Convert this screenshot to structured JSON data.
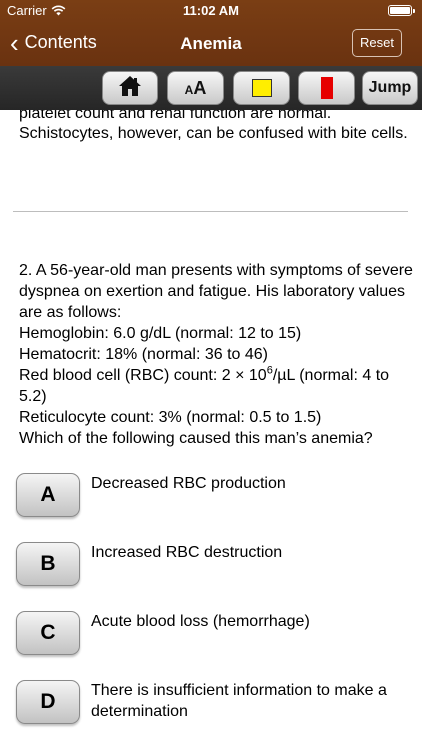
{
  "status_bar": {
    "carrier": "Carrier",
    "time": "11:02 AM"
  },
  "nav": {
    "back_label": "Contents",
    "title": "Anemia",
    "reset_label": "Reset"
  },
  "toolbar": {
    "font_label_small": "A",
    "font_label_large": "A",
    "jump_label": "Jump",
    "highlight_color": "#ffee00",
    "marker_color": "#e60000"
  },
  "previous_text": {
    "line1": "platelet count and renal function are normal.",
    "line2": "Schistocytes, however, can be confused with bite cells."
  },
  "question": {
    "intro": "2. A 56-year-old man presents with symptoms of severe dyspnea on exertion and fatigue. His laboratory values are as follows:",
    "hemoglobin": "Hemoglobin: 6.0 g/dL (normal: 12 to 15)",
    "hematocrit": "Hematocrit: 18% (normal: 36 to 46)",
    "rbc_prefix": "Red blood cell (RBC) count: 2 × 10",
    "rbc_exponent": "6",
    "rbc_suffix": "/µL (normal: 4 to 5.2)",
    "reticulocyte": "Reticulocyte count: 3% (normal: 0.5 to 1.5)",
    "prompt": "Which of the following caused this man’s anemia?"
  },
  "answers": [
    {
      "letter": "A",
      "text": "Decreased RBC production"
    },
    {
      "letter": "B",
      "text": "Increased RBC destruction"
    },
    {
      "letter": "C",
      "text": "Acute blood loss (hemorrhage)"
    },
    {
      "letter": "D",
      "text": "There is insufficient information to make a determination"
    }
  ]
}
